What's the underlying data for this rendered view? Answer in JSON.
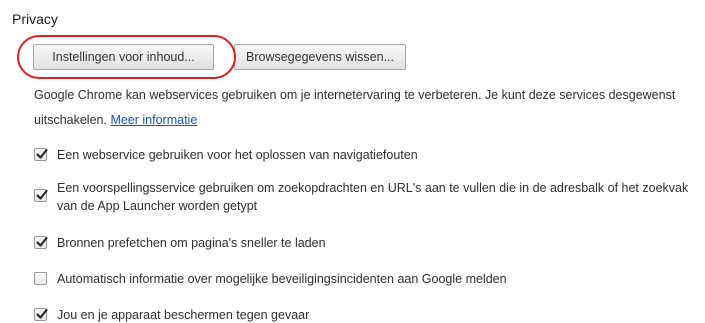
{
  "section": {
    "title": "Privacy"
  },
  "buttons": {
    "content_settings": "Instellingen voor inhoud...",
    "clear_browsing": "Browsegegevens wissen..."
  },
  "description": {
    "text": "Google Chrome kan webservices gebruiken om je internetervaring te verbeteren. Je kunt deze services desgewenst uitschakelen.",
    "link": "Meer informatie"
  },
  "options": [
    {
      "label": "Een webservice gebruiken voor het oplossen van navigatiefouten",
      "checked": true
    },
    {
      "label": "Een voorspellingsservice gebruiken om zoekopdrachten en URL's aan te vullen die in de adresbalk of het zoekvak van de App Launcher worden getypt",
      "checked": true
    },
    {
      "label": "Bronnen prefetchen om pagina's sneller te laden",
      "checked": true
    },
    {
      "label": "Automatisch informatie over mogelijke beveiligingsincidenten aan Google melden",
      "checked": false
    },
    {
      "label": "Jou en je apparaat beschermen tegen gevaar",
      "checked": true
    }
  ],
  "colors": {
    "highlight": "#e02020",
    "link": "#1155cc"
  }
}
